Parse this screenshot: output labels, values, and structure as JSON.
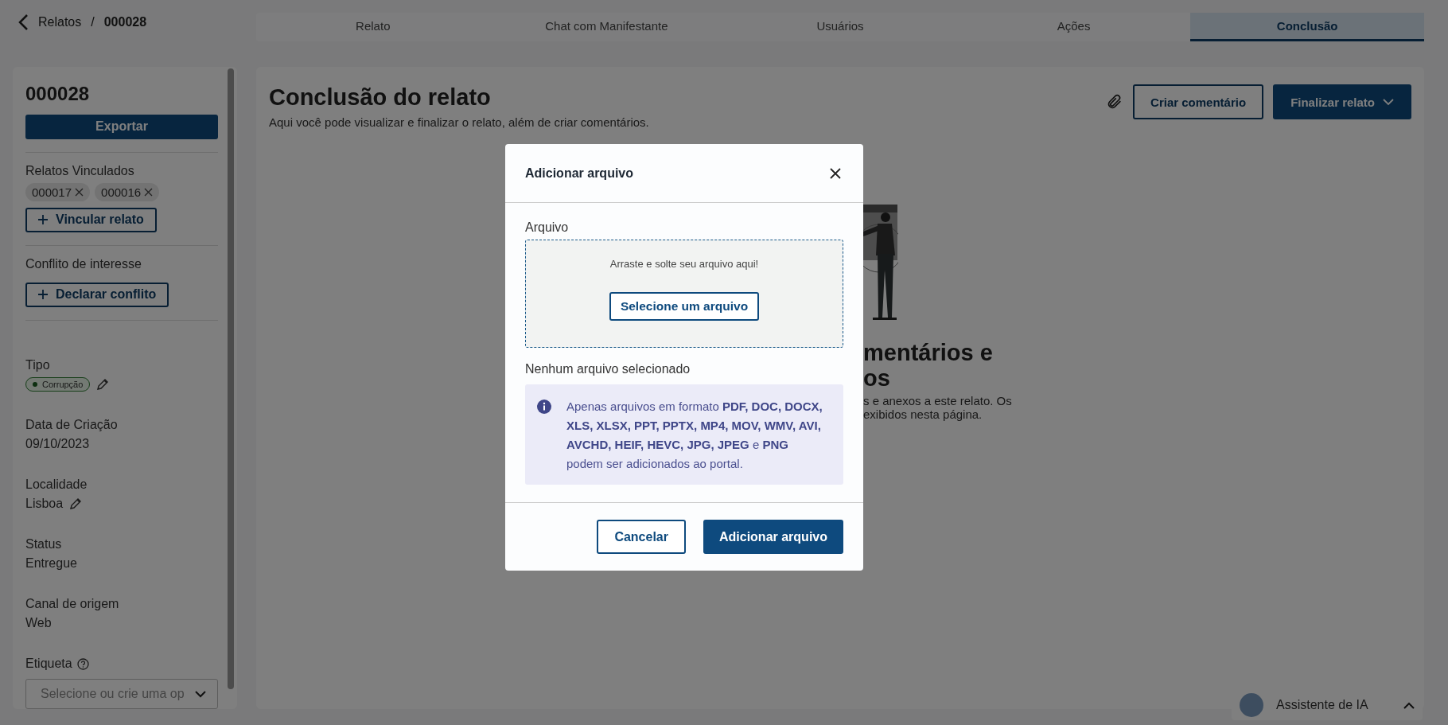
{
  "breadcrumb": {
    "parent": "Relatos",
    "separator": "/",
    "current": "000028"
  },
  "tabs": [
    {
      "label": "Relato",
      "selected": false
    },
    {
      "label": "Chat com Manifestante",
      "selected": false
    },
    {
      "label": "Usuários",
      "selected": false
    },
    {
      "label": "Ações",
      "selected": false
    },
    {
      "label": "Conclusão",
      "selected": true
    }
  ],
  "sidebar": {
    "id": "000028",
    "export_button": "Exportar",
    "linked": {
      "label": "Relatos Vinculados",
      "chips": [
        "000017",
        "000016"
      ],
      "button": "Vincular relato"
    },
    "conflict": {
      "label": "Conflito de interesse",
      "button": "Declarar conflito"
    },
    "fields": [
      {
        "label": "Tipo",
        "kind": "tag",
        "value": "Corrupção",
        "editable": true
      },
      {
        "label": "Data de Criação",
        "kind": "text",
        "value": "09/10/2023",
        "editable": false
      },
      {
        "label": "Localidade",
        "kind": "text",
        "value": "Lisboa",
        "editable": true
      },
      {
        "label": "Status",
        "kind": "text",
        "value": "Entregue",
        "editable": false
      },
      {
        "label": "Canal de origem",
        "kind": "text",
        "value": "Web",
        "editable": false
      }
    ],
    "tag_field": {
      "label": "Etiqueta",
      "placeholder": "Selecione ou crie uma op"
    }
  },
  "main": {
    "title": "Conclusão do relato",
    "subtitle": "Aqui você pode visualizar e finalizar o relato, além de criar comentários.",
    "comment_button": "Criar comentário",
    "finalize_button": "Finalizar relato",
    "empty_state": {
      "title_lines": [
        "mentários e",
        "os"
      ],
      "text_lines": [
        "s e anexos a este relato. Os",
        "exibidos nesta página."
      ]
    }
  },
  "dialog": {
    "title": "Adicionar arquivo",
    "field_label": "Arquivo",
    "drop_hint": "Arraste e solte seu arquivo aqui!",
    "select_button": "Selecione um arquivo",
    "status": "Nenhum arquivo selecionado",
    "info": "Apenas arquivos em formato **PDF, DOC, DOCX, XLS, XLSX, PPT, PPTX, MP4, MOV, WMV, AVI, AVCHD, HEIF, HEVC, JPG, JPEG** e **PNG** podem ser adicionados ao portal.",
    "cancel_button": "Cancelar",
    "confirm_button": "Adicionar arquivo"
  },
  "assistant": {
    "label": "Assistente de IA",
    "expanded": false
  }
}
